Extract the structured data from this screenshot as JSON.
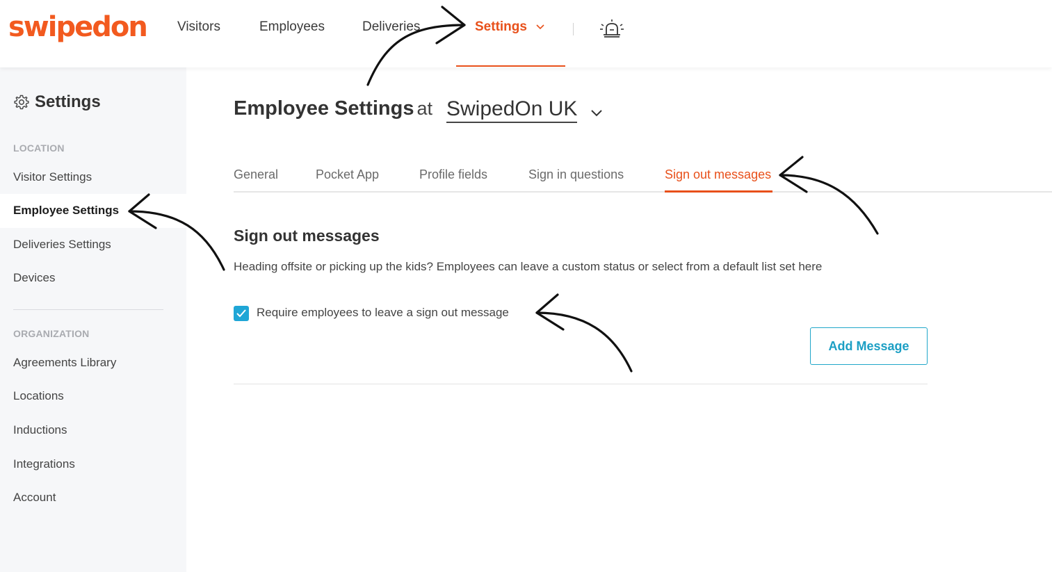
{
  "brand": {
    "logo_text": "swipedon",
    "accent": "#e8501a",
    "link": "#1fa6d6"
  },
  "nav": {
    "items": [
      {
        "label": "Visitors"
      },
      {
        "label": "Employees"
      },
      {
        "label": "Deliveries"
      },
      {
        "label": "Settings",
        "active": true
      }
    ],
    "settings_chevron_icon": "chevron-down-icon",
    "alarm_icon": "alarm-light-icon"
  },
  "sidebar": {
    "title": "Settings",
    "title_icon": "gear-icon",
    "location_section": "LOCATION",
    "location_items": [
      {
        "label": "Visitor Settings"
      },
      {
        "label": "Employee Settings",
        "active": true
      },
      {
        "label": "Deliveries Settings"
      },
      {
        "label": "Devices"
      }
    ],
    "organization_section": "ORGANIZATION",
    "organization_items": [
      {
        "label": "Agreements Library"
      },
      {
        "label": "Locations"
      },
      {
        "label": "Inductions"
      },
      {
        "label": "Integrations"
      },
      {
        "label": "Account"
      }
    ]
  },
  "main": {
    "heading": "Employee Settings",
    "heading_at": "at",
    "location": "SwipedOn UK",
    "tabs": [
      {
        "label": "General"
      },
      {
        "label": "Pocket App"
      },
      {
        "label": "Profile fields"
      },
      {
        "label": "Sign in questions"
      },
      {
        "label": "Sign out messages",
        "active": true
      }
    ],
    "section_title": "Sign out messages",
    "section_desc": "Heading offsite or picking up the kids? Employees can leave a custom status or select from a default list set here",
    "require_checkbox": {
      "label": "Require employees to leave a sign out message",
      "checked": true
    },
    "add_button": "Add Message"
  }
}
